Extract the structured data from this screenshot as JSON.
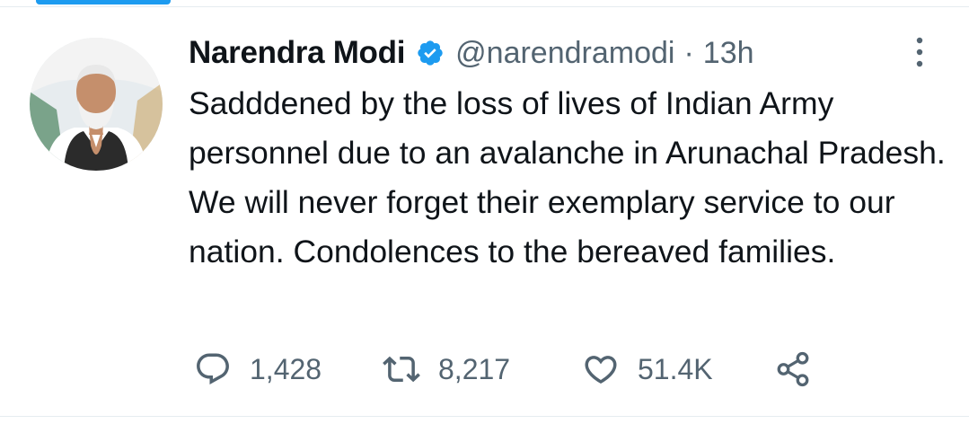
{
  "tweet": {
    "author_name": "Narendra Modi",
    "handle": "@narendramodi",
    "separator": "·",
    "time": "13h",
    "text": "Sadddened by the loss of lives of Indian Army personnel due to an avalanche in Arunachal Pradesh. We will never forget their exemplary service to our nation. Condolences to the bereaved families.",
    "verified": true
  },
  "actions": {
    "replies": "1,428",
    "retweets": "8,217",
    "likes": "51.4K"
  },
  "icons": {
    "more": "more-vertical-icon",
    "verified": "verified-badge-icon",
    "reply": "reply-icon",
    "retweet": "retweet-icon",
    "like": "heart-icon",
    "share": "share-icon"
  },
  "colors": {
    "accent": "#1d9bf0",
    "text": "#0f1419",
    "secondary": "#536471",
    "divider": "#e6ecf0"
  }
}
